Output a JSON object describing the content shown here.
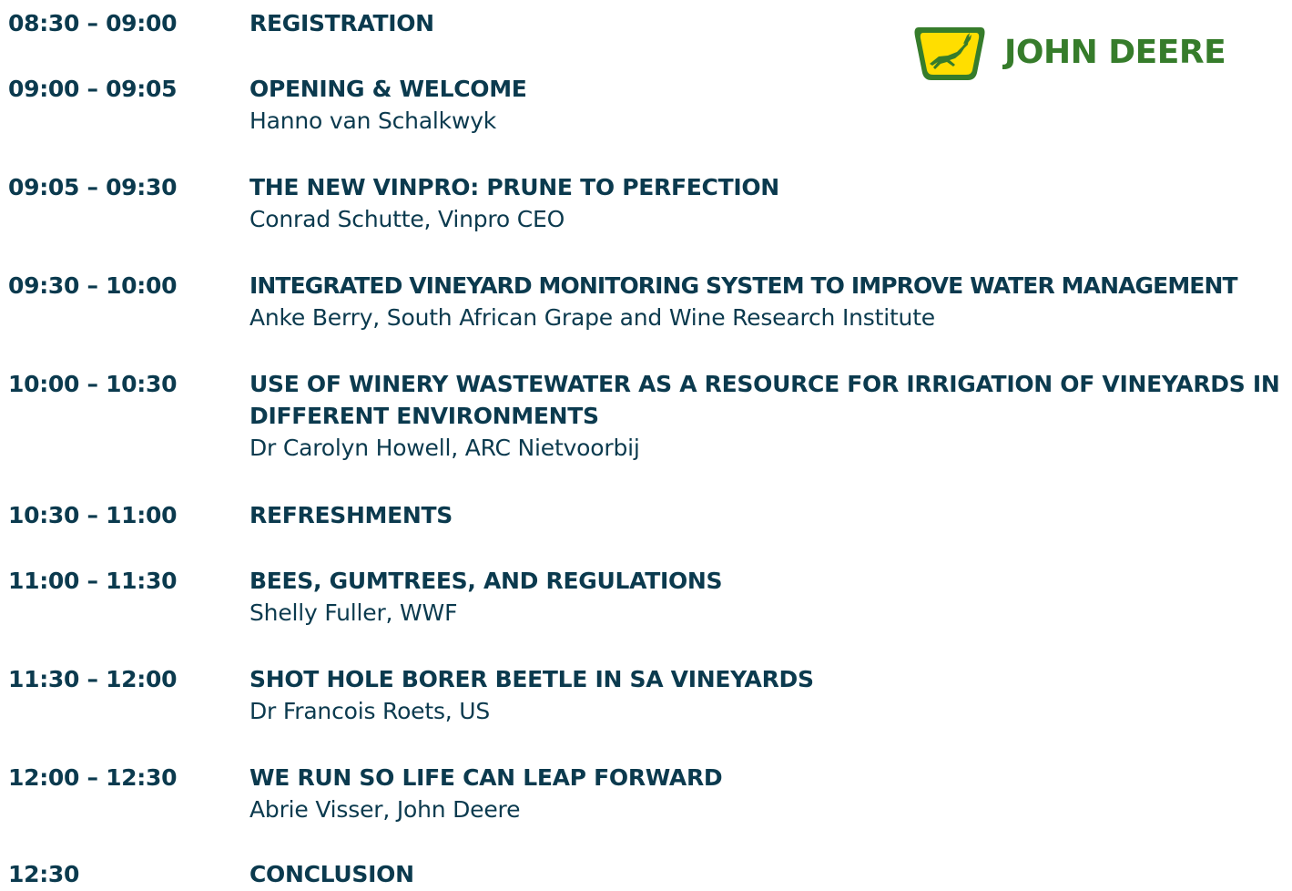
{
  "brand": {
    "name": "JOHN DEERE",
    "colors": {
      "green": "#367c2b",
      "yellow": "#ffde00"
    }
  },
  "agenda": [
    {
      "time": "08:30 – 09:00",
      "title": "REGISTRATION",
      "speaker": ""
    },
    {
      "time": "09:00 – 09:05",
      "title": "OPENING & WELCOME",
      "speaker": "Hanno van Schalkwyk"
    },
    {
      "time": "09:05 – 09:30",
      "title": "THE NEW VINPRO: PRUNE TO PERFECTION",
      "speaker": "Conrad Schutte, Vinpro CEO"
    },
    {
      "time": "09:30 – 10:00",
      "title": "INTEGRATED VINEYARD MONITORING SYSTEM TO IMPROVE WATER MANAGEMENT",
      "speaker": "Anke Berry, South African Grape and Wine Research Institute"
    },
    {
      "time": "10:00 – 10:30",
      "title": "USE OF WINERY WASTEWATER AS A RESOURCE FOR IRRIGATION OF VINEYARDS IN DIFFERENT ENVIRONMENTS",
      "speaker": "Dr Carolyn Howell, ARC Nietvoorbij"
    },
    {
      "time": "10:30 – 11:00",
      "title": "REFRESHMENTS",
      "speaker": ""
    },
    {
      "time": "11:00 – 11:30",
      "title": "BEES, GUMTREES, AND REGULATIONS",
      "speaker": "Shelly Fuller, WWF"
    },
    {
      "time": "11:30 – 12:00",
      "title": "SHOT HOLE BORER BEETLE IN SA VINEYARDS",
      "speaker": "Dr Francois Roets, US"
    },
    {
      "time": "12:00 – 12:30",
      "title": "WE RUN SO LIFE CAN LEAP FORWARD",
      "speaker": "Abrie Visser, John Deere"
    },
    {
      "time": "12:30",
      "title": "CONCLUSION",
      "speaker": ""
    }
  ]
}
